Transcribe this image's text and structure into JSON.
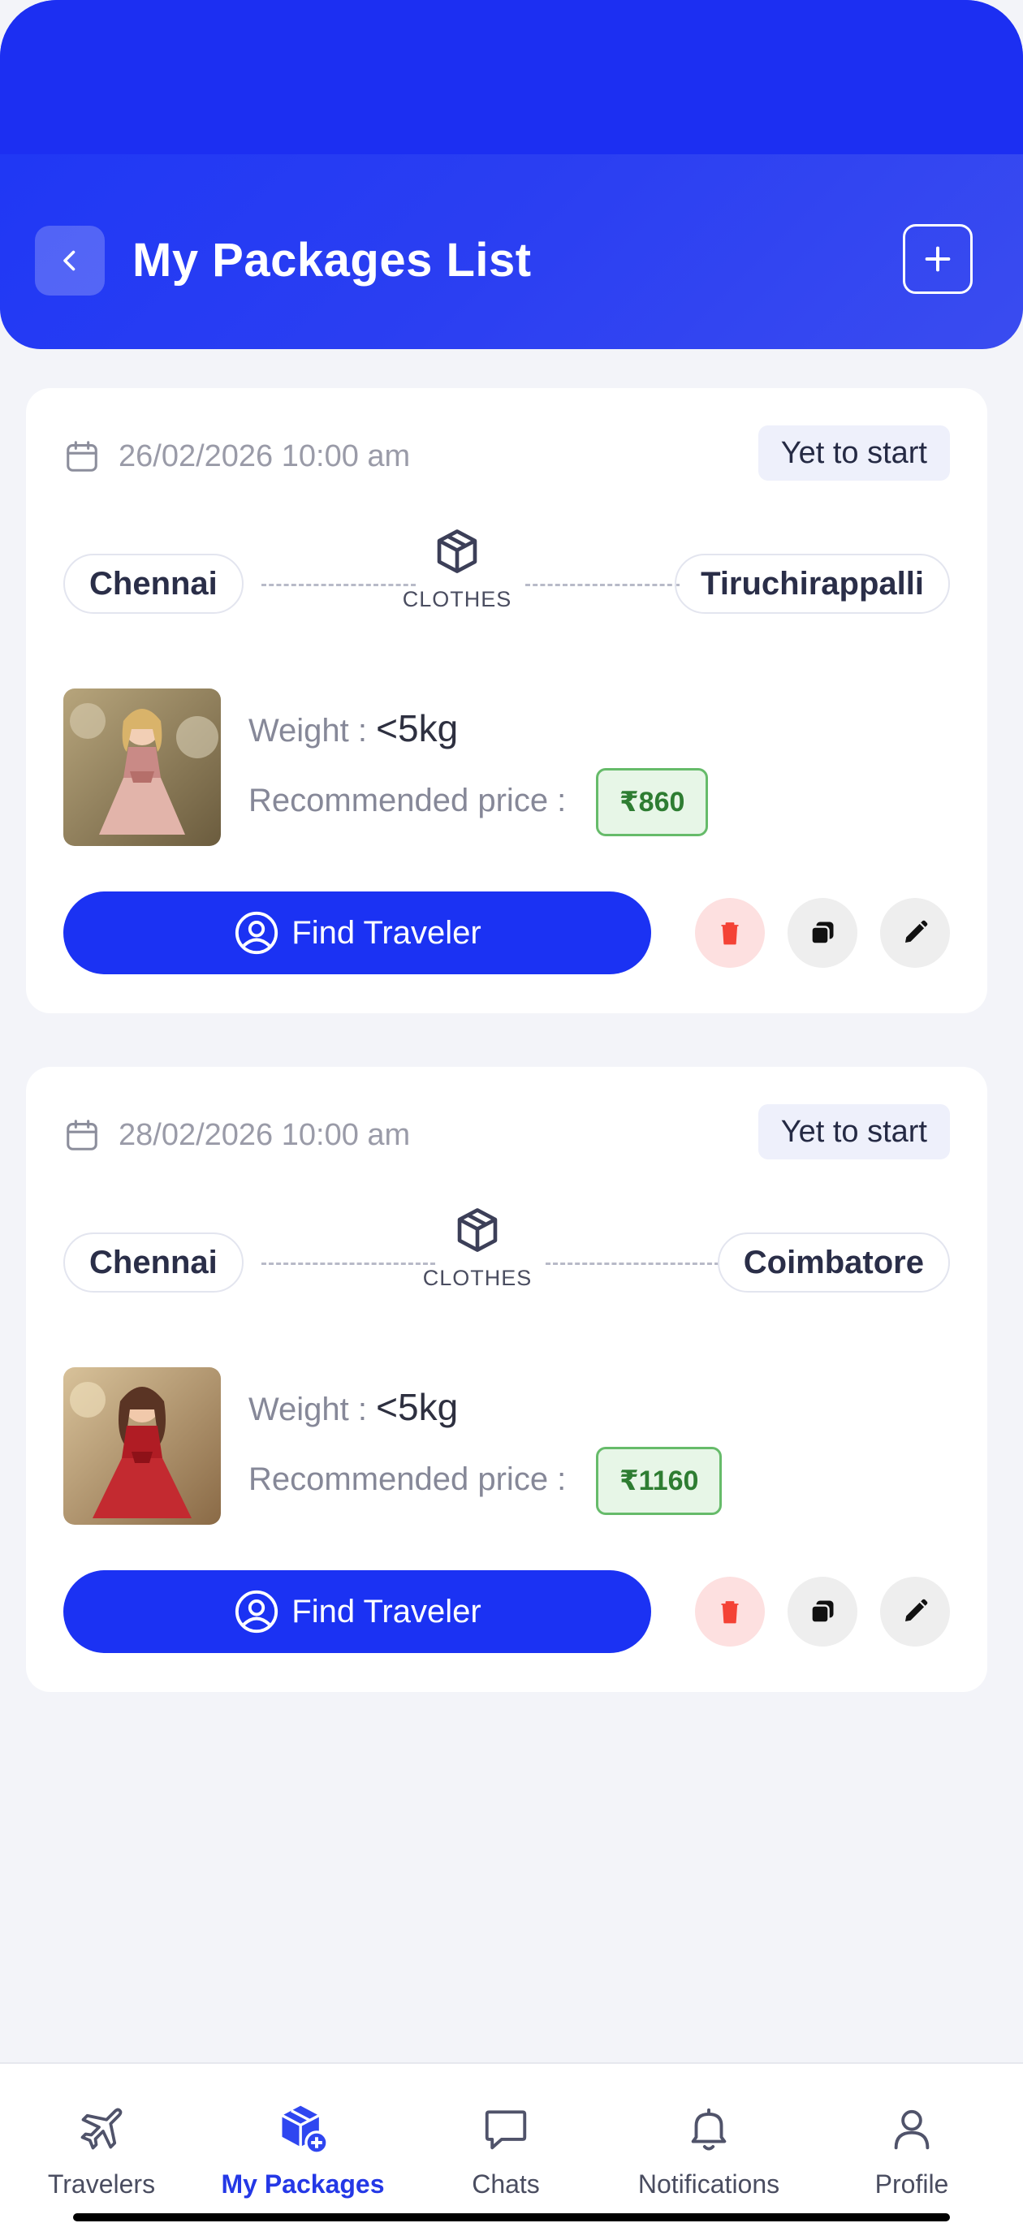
{
  "header": {
    "title": "My Packages List",
    "back_icon": "chevron-left-icon",
    "add_icon": "plus-icon",
    "color": "#1d36f5"
  },
  "packages": [
    {
      "date": "26/02/2026 10:00 am",
      "status": "Yet to start",
      "from": "Chennai",
      "to": "Tiruchirappalli",
      "category": "CLOTHES",
      "weight_label": "Weight :",
      "weight_value": "<5kg",
      "price_label": "Recommended price :",
      "price": "₹860",
      "action": "Find Traveler"
    },
    {
      "date": "28/02/2026 10:00 am",
      "status": "Yet to start",
      "from": "Chennai",
      "to": "Coimbatore",
      "category": "CLOTHES",
      "weight_label": "Weight :",
      "weight_value": "<5kg",
      "price_label": "Recommended price :",
      "price": "₹1160",
      "action": "Find Traveler"
    }
  ],
  "nav": {
    "items": [
      {
        "label": "Travelers",
        "icon": "airplane-icon"
      },
      {
        "label": "My Packages",
        "icon": "package-add-icon",
        "active": true
      },
      {
        "label": "Chats",
        "icon": "chat-bubble-icon"
      },
      {
        "label": "Notifications",
        "icon": "bell-icon"
      },
      {
        "label": "Profile",
        "icon": "person-icon"
      }
    ]
  },
  "colors": {
    "accent": "#1b32f3",
    "status_bg": "#eef0fb",
    "price_green": "#2e7d32",
    "delete_red": "#f44336"
  }
}
